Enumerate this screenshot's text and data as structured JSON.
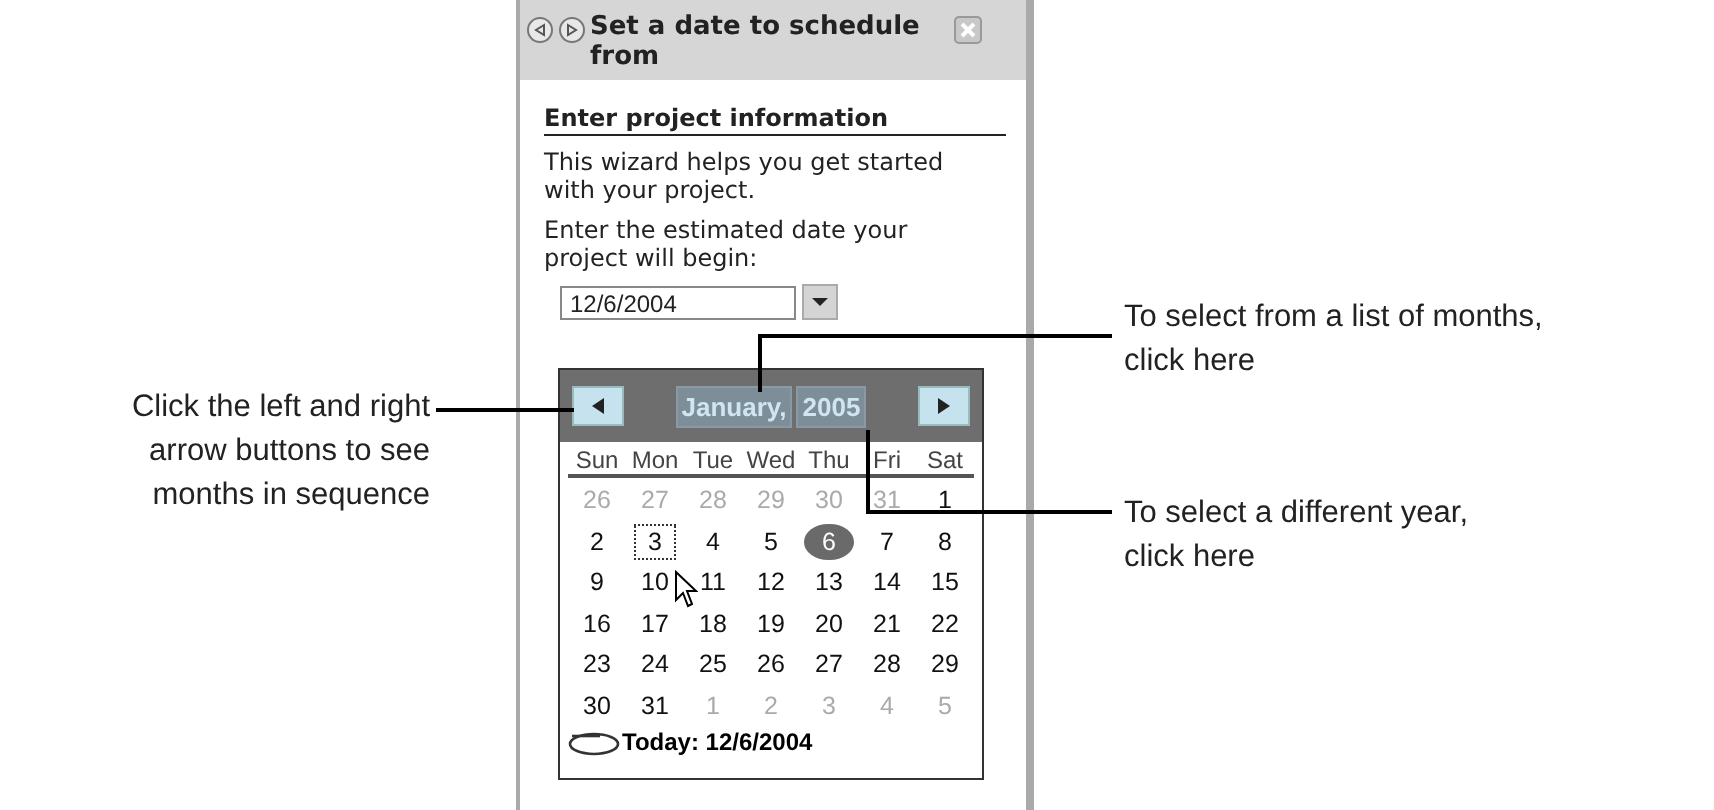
{
  "pane": {
    "title": "Set a date to schedule from",
    "heading": "Enter project information",
    "intro": "This wizard helps you get started with your project.",
    "prompt": "Enter the estimated date your project will begin:",
    "date_field": {
      "value": "12/6/2004"
    }
  },
  "calendar": {
    "month": "January,",
    "year": "2005",
    "weekdays": [
      "Sun",
      "Mon",
      "Tue",
      "Wed",
      "Thu",
      "Fri",
      "Sat"
    ],
    "days": [
      {
        "text": "26",
        "other_month": true,
        "selected": false,
        "focused": false
      },
      {
        "text": "27",
        "other_month": true,
        "selected": false,
        "focused": false
      },
      {
        "text": "28",
        "other_month": true,
        "selected": false,
        "focused": false
      },
      {
        "text": "29",
        "other_month": true,
        "selected": false,
        "focused": false
      },
      {
        "text": "30",
        "other_month": true,
        "selected": false,
        "focused": false
      },
      {
        "text": "31",
        "other_month": true,
        "selected": false,
        "focused": false
      },
      {
        "text": "1",
        "other_month": false,
        "selected": false,
        "focused": false
      },
      {
        "text": "2",
        "other_month": false,
        "selected": false,
        "focused": false
      },
      {
        "text": "3",
        "other_month": false,
        "selected": false,
        "focused": true
      },
      {
        "text": "4",
        "other_month": false,
        "selected": false,
        "focused": false
      },
      {
        "text": "5",
        "other_month": false,
        "selected": false,
        "focused": false
      },
      {
        "text": "6",
        "other_month": false,
        "selected": true,
        "focused": false
      },
      {
        "text": "7",
        "other_month": false,
        "selected": false,
        "focused": false
      },
      {
        "text": "8",
        "other_month": false,
        "selected": false,
        "focused": false
      },
      {
        "text": "9",
        "other_month": false,
        "selected": false,
        "focused": false
      },
      {
        "text": "10",
        "other_month": false,
        "selected": false,
        "focused": false
      },
      {
        "text": "11",
        "other_month": false,
        "selected": false,
        "focused": false
      },
      {
        "text": "12",
        "other_month": false,
        "selected": false,
        "focused": false
      },
      {
        "text": "13",
        "other_month": false,
        "selected": false,
        "focused": false
      },
      {
        "text": "14",
        "other_month": false,
        "selected": false,
        "focused": false
      },
      {
        "text": "15",
        "other_month": false,
        "selected": false,
        "focused": false
      },
      {
        "text": "16",
        "other_month": false,
        "selected": false,
        "focused": false
      },
      {
        "text": "17",
        "other_month": false,
        "selected": false,
        "focused": false
      },
      {
        "text": "18",
        "other_month": false,
        "selected": false,
        "focused": false
      },
      {
        "text": "19",
        "other_month": false,
        "selected": false,
        "focused": false
      },
      {
        "text": "20",
        "other_month": false,
        "selected": false,
        "focused": false
      },
      {
        "text": "21",
        "other_month": false,
        "selected": false,
        "focused": false
      },
      {
        "text": "22",
        "other_month": false,
        "selected": false,
        "focused": false
      },
      {
        "text": "23",
        "other_month": false,
        "selected": false,
        "focused": false
      },
      {
        "text": "24",
        "other_month": false,
        "selected": false,
        "focused": false
      },
      {
        "text": "25",
        "other_month": false,
        "selected": false,
        "focused": false
      },
      {
        "text": "26",
        "other_month": false,
        "selected": false,
        "focused": false
      },
      {
        "text": "27",
        "other_month": false,
        "selected": false,
        "focused": false
      },
      {
        "text": "28",
        "other_month": false,
        "selected": false,
        "focused": false
      },
      {
        "text": "29",
        "other_month": false,
        "selected": false,
        "focused": false
      },
      {
        "text": "30",
        "other_month": false,
        "selected": false,
        "focused": false
      },
      {
        "text": "31",
        "other_month": false,
        "selected": false,
        "focused": false
      },
      {
        "text": "1",
        "other_month": true,
        "selected": false,
        "focused": false
      },
      {
        "text": "2",
        "other_month": true,
        "selected": false,
        "focused": false
      },
      {
        "text": "3",
        "other_month": true,
        "selected": false,
        "focused": false
      },
      {
        "text": "4",
        "other_month": true,
        "selected": false,
        "focused": false
      },
      {
        "text": "5",
        "other_month": true,
        "selected": false,
        "focused": false
      }
    ],
    "today": "Today: 12/6/2004"
  },
  "callouts": [
    {
      "kind": "left",
      "lines": [
        "Click the left and right",
        "arrow buttons to see",
        "months in sequence"
      ]
    },
    {
      "kind": "month",
      "lines": [
        "To select from a list of months,",
        "click here"
      ]
    },
    {
      "kind": "year",
      "lines": [
        "To select a different year,",
        "click here"
      ]
    }
  ]
}
